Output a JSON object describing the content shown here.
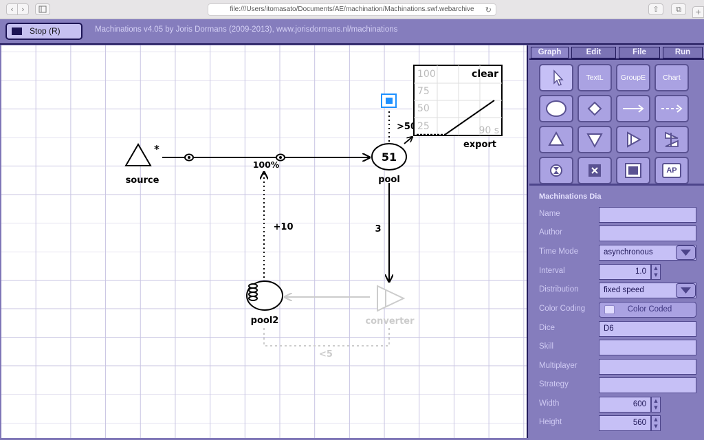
{
  "browser": {
    "url": "file:///Users/itomasato/Documents/AE/machination/Machinations.swf.webarchive",
    "back_icon": "‹",
    "forward_icon": "›",
    "reload_icon": "↻",
    "share_icon": "⇧",
    "tabs_icon": "⧉",
    "newtab_icon": "+"
  },
  "toolbar": {
    "stop_label": "Stop (R)",
    "credits": "Machinations v4.05 by Joris Dormans (2009-2013), www.jorisdormans.nl/machinations"
  },
  "diagram": {
    "source_label": "source",
    "source_star": "*",
    "rate_label": "100%",
    "pool_value": "51",
    "pool_label": "pool",
    "pool2_label": "pool2",
    "converter_label": "converter",
    "plus_label": "+10",
    "flow_label": "3",
    "trigger_label": ">50",
    "condition_label": "<5",
    "chart": {
      "clear_label": "clear",
      "export_label": "export",
      "time_label": "90 s",
      "ticks": [
        "100",
        "75",
        "50",
        "25"
      ]
    }
  },
  "tabs": {
    "graph": "Graph",
    "edit": "Edit",
    "file": "File",
    "run": "Run"
  },
  "tools": {
    "text": "TextL",
    "group": "GroupE",
    "chart": "Chart",
    "ap": "AP"
  },
  "panel": {
    "title": "Machinations Dia",
    "name_label": "Name",
    "name_value": "",
    "author_label": "Author",
    "author_value": "",
    "timemode_label": "Time Mode",
    "timemode_value": "asynchronous",
    "interval_label": "Interval",
    "interval_value": "1.0",
    "distribution_label": "Distribution",
    "distribution_value": "fixed speed",
    "colorcoding_label": "Color Coding",
    "colorcoding_value": "Color Coded",
    "dice_label": "Dice",
    "dice_value": "D6",
    "skill_label": "Skill",
    "skill_value": "",
    "multiplayer_label": "Multiplayer",
    "multiplayer_value": "",
    "strategy_label": "Strategy",
    "strategy_value": "",
    "width_label": "Width",
    "width_value": "600",
    "height_label": "Height",
    "height_value": "560"
  },
  "colors": {
    "panel_bg": "#857dbd",
    "field_bg": "#c6c0f6",
    "dark": "#221a5c",
    "selected_blue": "#1e90ff"
  }
}
